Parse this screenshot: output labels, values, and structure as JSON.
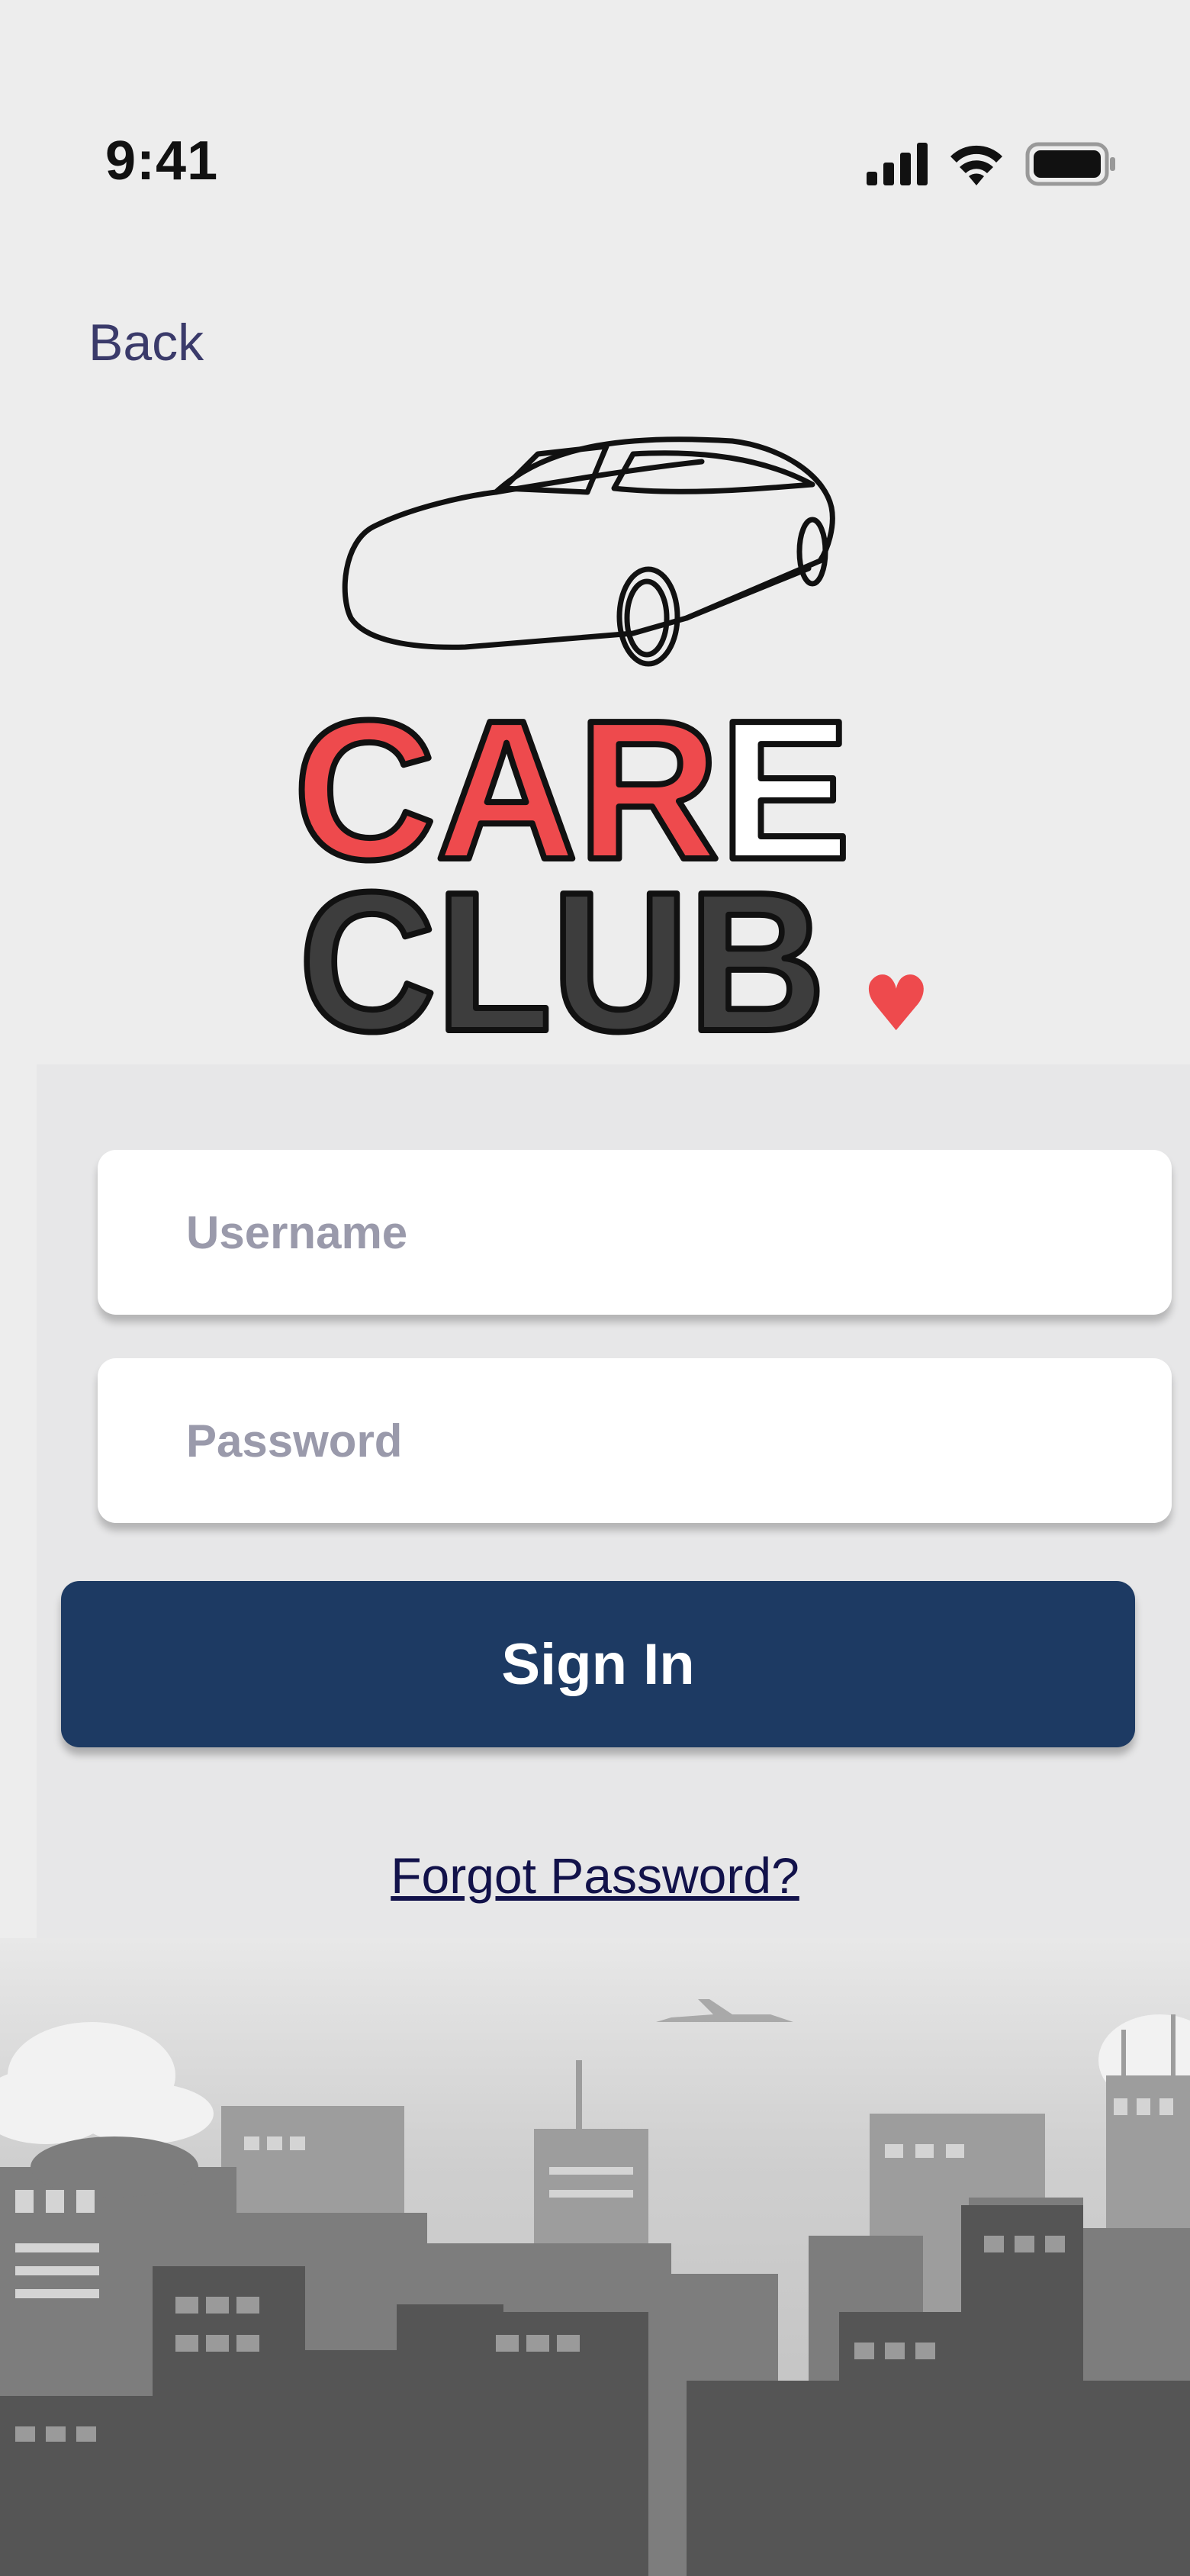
{
  "status_bar": {
    "time": "9:41",
    "icons": [
      "signal-icon",
      "wifi-icon",
      "battery-icon"
    ]
  },
  "nav": {
    "back_label": "Back"
  },
  "logo": {
    "line1_red": "CAR",
    "line1_white": "E",
    "line2": "CLUB",
    "accent": "♥"
  },
  "form": {
    "username_placeholder": "Username",
    "password_placeholder": "Password",
    "signin_label": "Sign In",
    "forgot_label": "Forgot Password?"
  },
  "colors": {
    "brand_red": "#ee4a4d",
    "brand_dark": "#3d3d3d",
    "primary_button": "#1d3a63",
    "link": "#12124a",
    "background": "#ededed"
  }
}
